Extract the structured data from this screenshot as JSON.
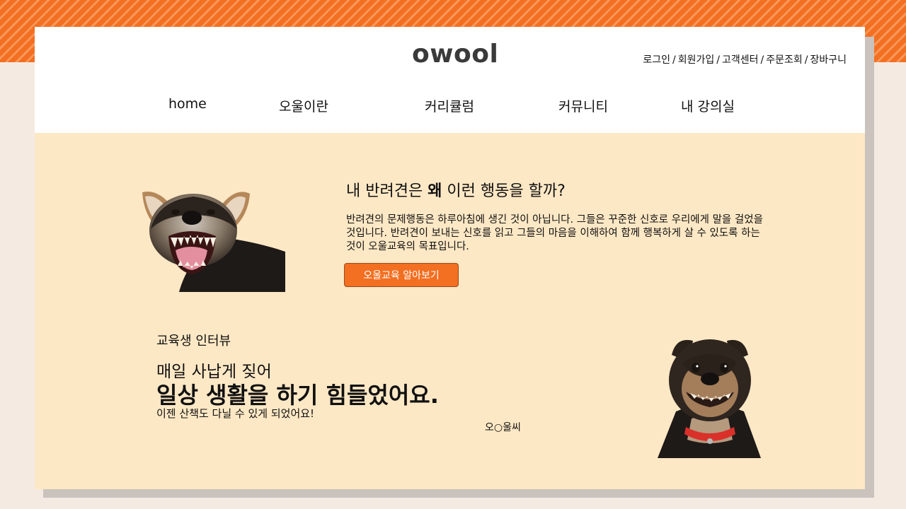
{
  "header": {
    "logo": "owool",
    "util_links": [
      "로그인",
      "회원가입",
      "고객센터",
      "주문조회",
      "장바구니"
    ],
    "util_separator": "/"
  },
  "nav": {
    "items": [
      "home",
      "오울이란",
      "커리큘럼",
      "커뮤니티",
      "내 강의실"
    ]
  },
  "hero": {
    "title_prefix": "내 반려견은 ",
    "title_emphasis": "왜",
    "title_suffix": " 이런 행동을 할까?",
    "description": "반려견의 문제행동은 하루아침에 생긴 것이 아닙니다. 그들은 꾸준한 신호로 우리에게 말을 걸었을 것입니다. 반려견이 보내는 신호를 읽고 그들의 마음을 이해하여 함께 행복하게 살 수 있도록 하는 것이 오울교육의 목표입니다.",
    "button_label": "오울교육 알아보기"
  },
  "interview": {
    "label": "교육생 인터뷰",
    "line1": "매일 사납게 짖어",
    "line2": "일상 생활을 하기 힘들었어요.",
    "line3": "이젠 산책도 다닐 수 있게 되었어요!",
    "author": "오○울씨"
  },
  "colors": {
    "accent": "#f36f21",
    "panel_background": "#fde8c5",
    "page_background": "#f5eae2",
    "logo_text": "#3a3a3a"
  },
  "icons": {
    "hero_image": "angry-dog-photo",
    "interview_image": "smiling-dog-photo"
  }
}
